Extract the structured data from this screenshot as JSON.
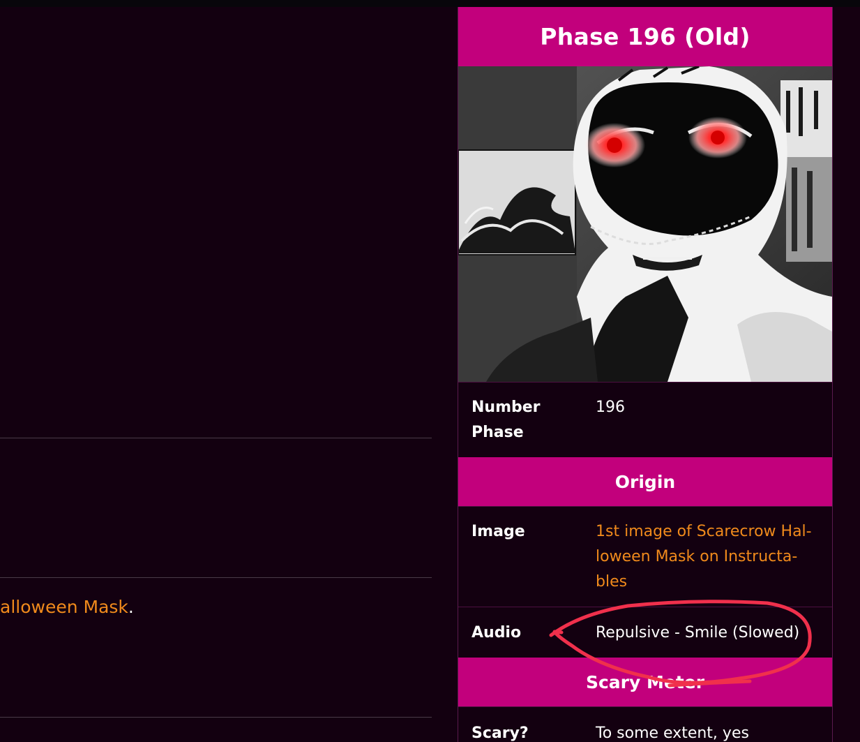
{
  "article": {
    "text_link": "alloween Mask",
    "text_suffix": "."
  },
  "infobox": {
    "title": "Phase 196 (Old)",
    "rows": {
      "number_phase": {
        "label_line1": "Number",
        "label_line2": "Phase",
        "value": "196"
      },
      "image": {
        "label": "Image",
        "value_lines": [
          "1st image of Scarecrow Hal-",
          "loween Mask on Instructa-",
          "bles"
        ]
      },
      "audio": {
        "label": "Audio",
        "value": "Repulsive - Smile (Slowed)"
      },
      "scary": {
        "label": "Scary?",
        "value": "To some extent, yes"
      }
    },
    "sections": {
      "origin": "Origin",
      "scary_meter": "Scary Meter"
    }
  },
  "colors": {
    "background": "#130010",
    "accent_magenta": "#c2007c",
    "link_orange": "#f08a1c",
    "annotation_red": "#f0304c"
  }
}
